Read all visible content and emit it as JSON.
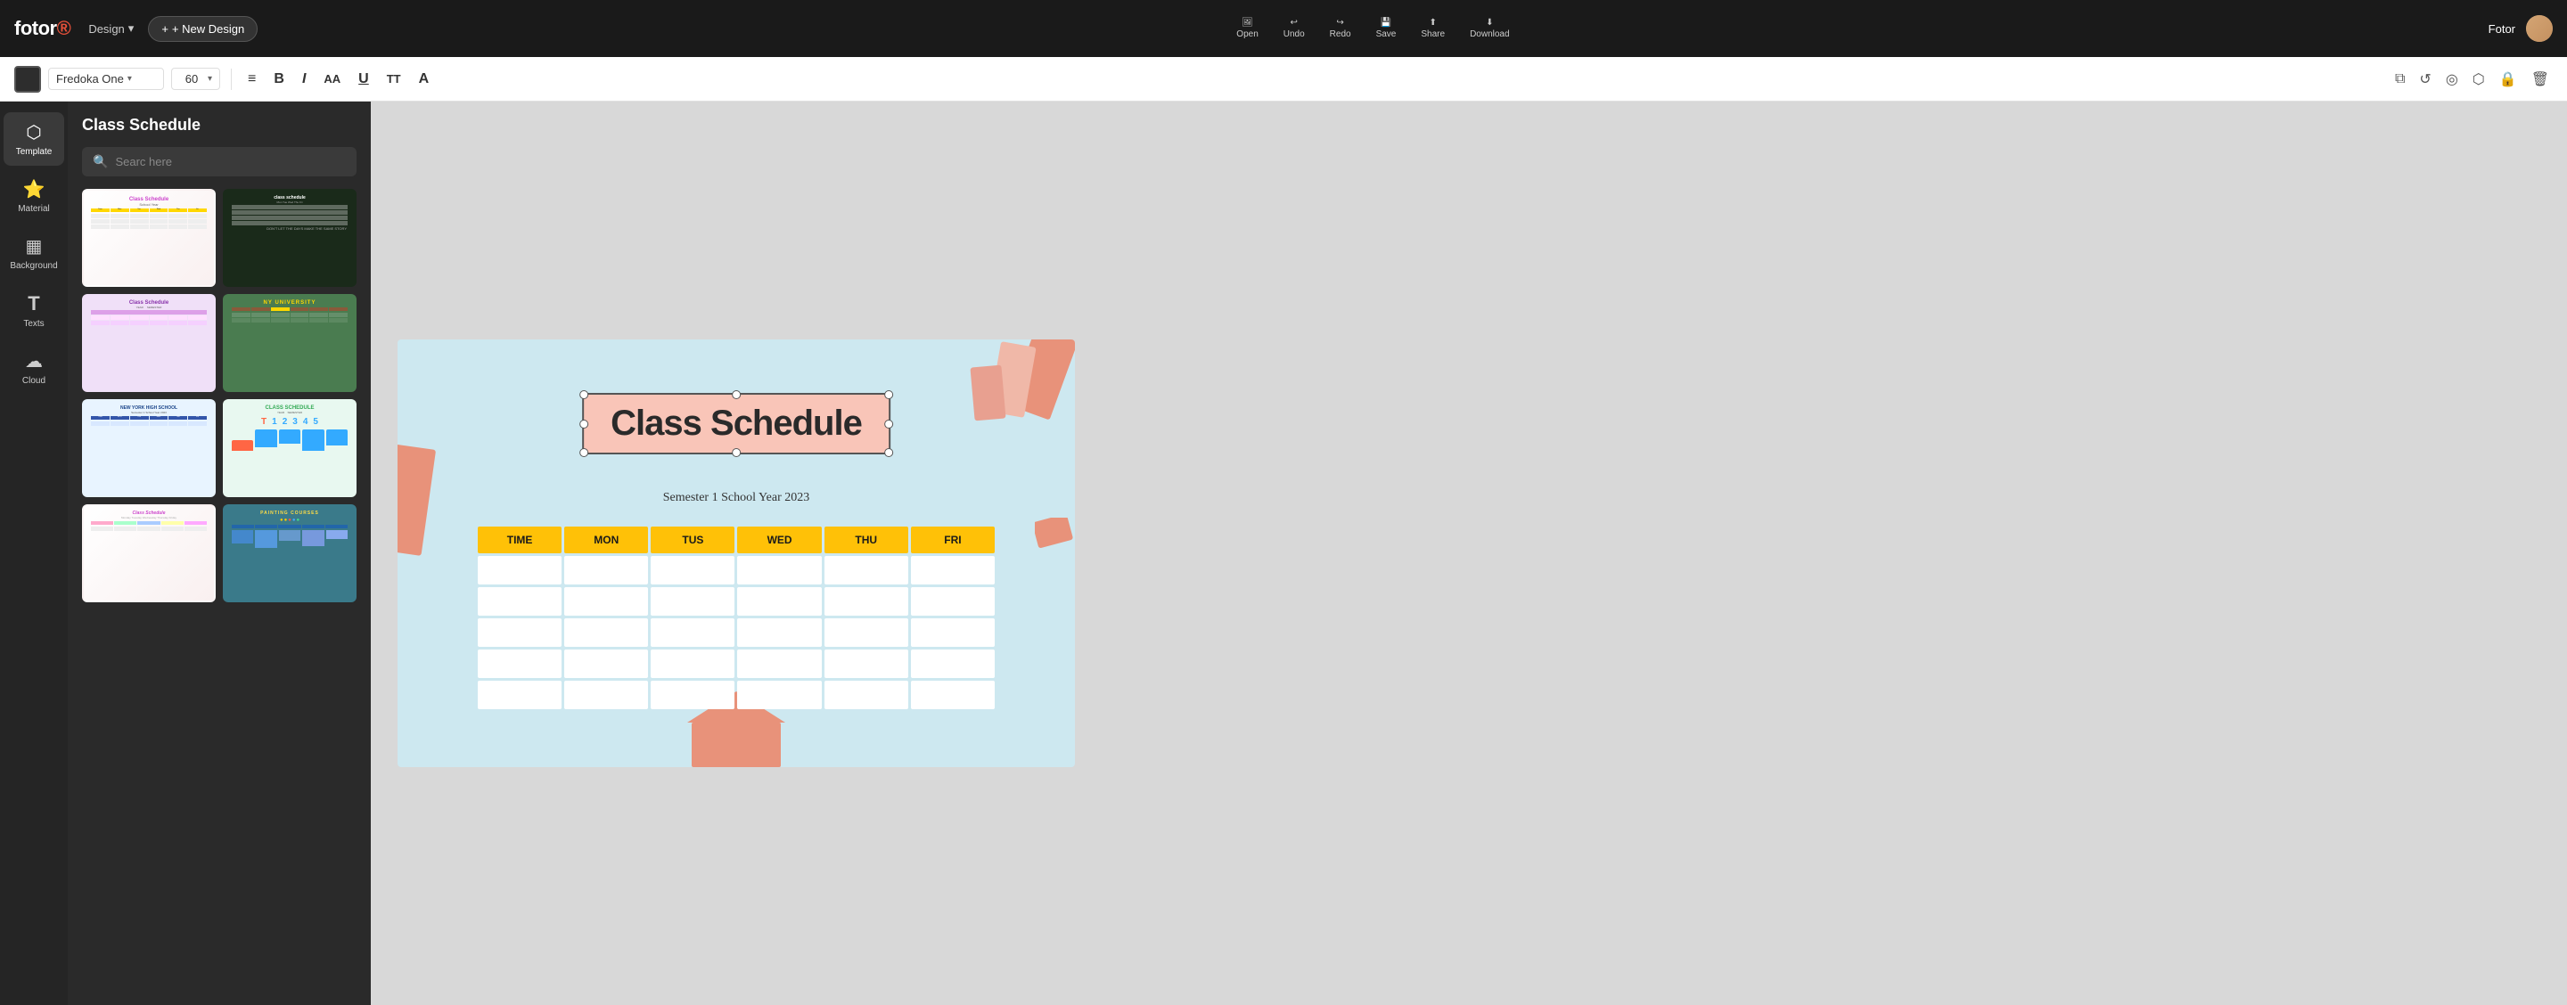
{
  "app": {
    "name": "Fotor",
    "design_label": "Design"
  },
  "header": {
    "new_design_label": "+ New Design",
    "toolbar_items": [
      {
        "icon": "🖼",
        "label": "Open"
      },
      {
        "icon": "↩",
        "label": "Undo"
      },
      {
        "icon": "↪",
        "label": "Redo"
      },
      {
        "icon": "💾",
        "label": "Save"
      },
      {
        "icon": "⬆",
        "label": "Share"
      },
      {
        "icon": "⬇",
        "label": "Download"
      }
    ],
    "user_name": "Fotor"
  },
  "format_toolbar": {
    "color_value": "#2d2d2d",
    "font_name": "Fredoka One",
    "font_size": "60",
    "buttons": [
      "≡",
      "B",
      "I",
      "AA",
      "U",
      "TT",
      "A"
    ],
    "right_buttons": [
      "⧉",
      "↺",
      "◎",
      "⬡",
      "🔒",
      "🗑"
    ]
  },
  "sidebar": {
    "items": [
      {
        "id": "template",
        "icon": "⬡",
        "label": "Template",
        "active": true
      },
      {
        "id": "material",
        "icon": "⭐",
        "label": "Material",
        "active": false
      },
      {
        "id": "background",
        "icon": "▦",
        "label": "Background",
        "active": false
      },
      {
        "id": "texts",
        "icon": "T",
        "label": "Texts",
        "active": false
      },
      {
        "id": "cloud",
        "icon": "☁",
        "label": "Cloud",
        "active": false
      }
    ]
  },
  "panel": {
    "title": "Class Schedule",
    "search_placeholder": "Searc here"
  },
  "canvas": {
    "title": "Class Schedule",
    "subtitle": "Semester 1 School Year 2023",
    "table": {
      "headers": [
        "TIME",
        "MON",
        "TUS",
        "WED",
        "THU",
        "FRI"
      ],
      "rows": 5
    }
  },
  "templates": [
    {
      "id": 1,
      "name": "class-schedule-pink"
    },
    {
      "id": 2,
      "name": "class-schedule-dark-floral"
    },
    {
      "id": 3,
      "name": "class-schedule-purple"
    },
    {
      "id": 4,
      "name": "ny-university"
    },
    {
      "id": 5,
      "name": "ny-high-school"
    },
    {
      "id": 6,
      "name": "class-schedule-dino"
    },
    {
      "id": 7,
      "name": "class-schedule-colorful"
    },
    {
      "id": 8,
      "name": "painting-courses"
    }
  ]
}
